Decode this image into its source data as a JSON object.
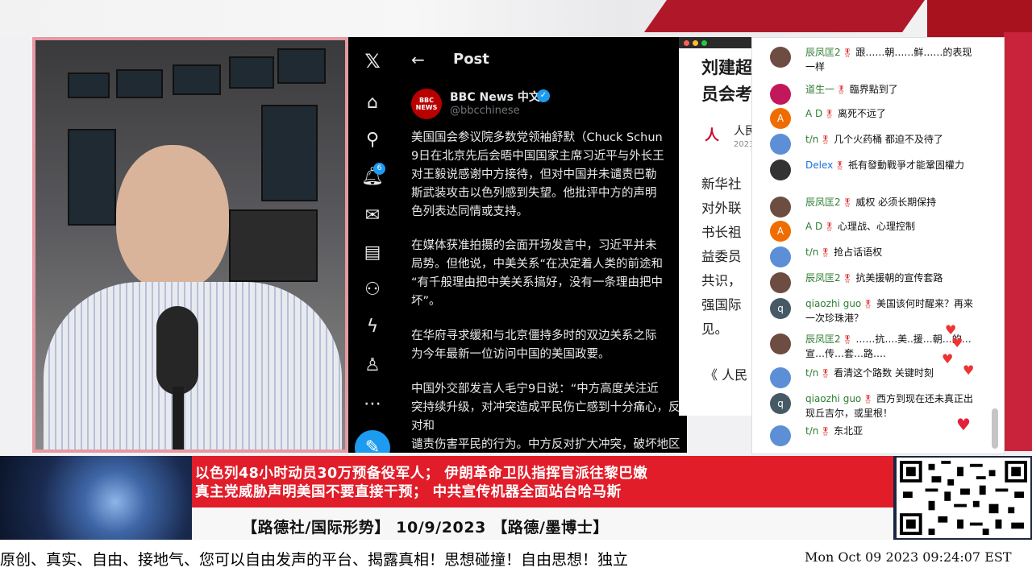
{
  "twitter": {
    "nav_badge_count": "6",
    "post_header": "Post",
    "author_name": "BBC News 中文",
    "author_handle": "@bbcchinese",
    "avatar_text": "BBC NEWS",
    "paragraphs": [
      "美国国会参议院多数党领袖舒默（Chuck Schun\n9日在北京先后会晤中国国家主席习近平与外长王\n对王毅说感谢中方接待，但对中国并未谴责巴勒\n斯武装攻击以色列感到失望。他批评中方的声明\n色列表达同情或支持。",
      "在媒体获准拍摄的会面开场发言中，习近平并未\n局势。但他说，中美关系“在决定着人类的前途和\n“有千般理由把中美关系搞好，没有一条理由把中\n坏”。",
      "在华府寻求缓和与北京僵持多时的双边关系之际\n为今年最新一位访问中国的美国政要。",
      "中国外交部发言人毛宁9日说：“中方高度关注近\n突持续升级，对冲突造成平民伤亡感到十分痛心，反对和\n谴责伤害平民的行为。中方反对扩大冲突，破坏地区稳定\n的行动，希望尽快停火止战，恢复和平。国际社会应切实"
    ]
  },
  "article": {
    "title": "刘建超\n员会考",
    "source": "人民",
    "date": "2023",
    "body": "新华社\n对外联\n书长祖\n益委员\n共识，\n强国际\n见。",
    "quote": "《 人民"
  },
  "chat": {
    "messages": [
      {
        "author": "辰凤匡2",
        "text": "跟……朝……鲜……的表现一样",
        "avatar_color": "#6d4c41"
      },
      {
        "author": "道生一",
        "text": "臨界點到了",
        "avatar_color": "#c2185b"
      },
      {
        "author": "A D",
        "text": "离死不远了",
        "avatar_color": "#ef6c00",
        "initial": "A"
      },
      {
        "author": "t/n",
        "text": "几个火药桶 都迫不及待了",
        "avatar_color": "#5c8fd6"
      },
      {
        "author": "Delex",
        "text": "祇有發動戰爭才能鞏固權力",
        "avatar_color": "#333333"
      },
      {
        "author": "辰凤匡2",
        "text": "威权 必须长期保持",
        "avatar_color": "#6d4c41"
      },
      {
        "author": "A D",
        "text": "心理战、心理控制",
        "avatar_color": "#ef6c00",
        "initial": "A"
      },
      {
        "author": "t/n",
        "text": "抢占话语权",
        "avatar_color": "#5c8fd6"
      },
      {
        "author": "辰凤匡2",
        "text": "抗美援朝的宣传套路",
        "avatar_color": "#6d4c41"
      },
      {
        "author": "qiaozhi guo",
        "text": "美国该何时醒来？再来一次珍珠港？",
        "avatar_color": "#455a64",
        "initial": "q"
      },
      {
        "author": "辰凤匡2",
        "text": "……抗….美..援…朝…的…宣…传…套…路….",
        "avatar_color": "#6d4c41"
      },
      {
        "author": "t/n",
        "text": "看清这个路数 关键时刻",
        "avatar_color": "#5c8fd6"
      },
      {
        "author": "qiaozhi guo",
        "text": "西方到现在还未真正出现丘吉尔，或里根！",
        "avatar_color": "#455a64",
        "initial": "q"
      },
      {
        "author": "t/n",
        "text": "东北亚",
        "avatar_color": "#5c8fd6"
      }
    ]
  },
  "banner": {
    "headline_line1": "以色列48小时动员30万预备役军人； 伊朗革命卫队指挥官派往黎巴嫩",
    "headline_line2": "真主党威胁声明美国不要直接干预； 中共宣传机器全面站台哈马斯",
    "program_line": "【路德社/国际形势】 10/9/2023 【路德/墨博士】"
  },
  "ticker": {
    "text": "原创、真实、自由、接地气、您可以自由发声的平台、揭露真相！思想碰撞！自由思想！独立",
    "timestamp": "Mon Oct 09 2023 09:24:07 EST"
  },
  "colors": {
    "banner_red": "#e11d2a",
    "twitter_blue": "#1d9bf0",
    "chat_author_green": "#2e7d32",
    "chat_author_blue": "#1e6fd9"
  }
}
